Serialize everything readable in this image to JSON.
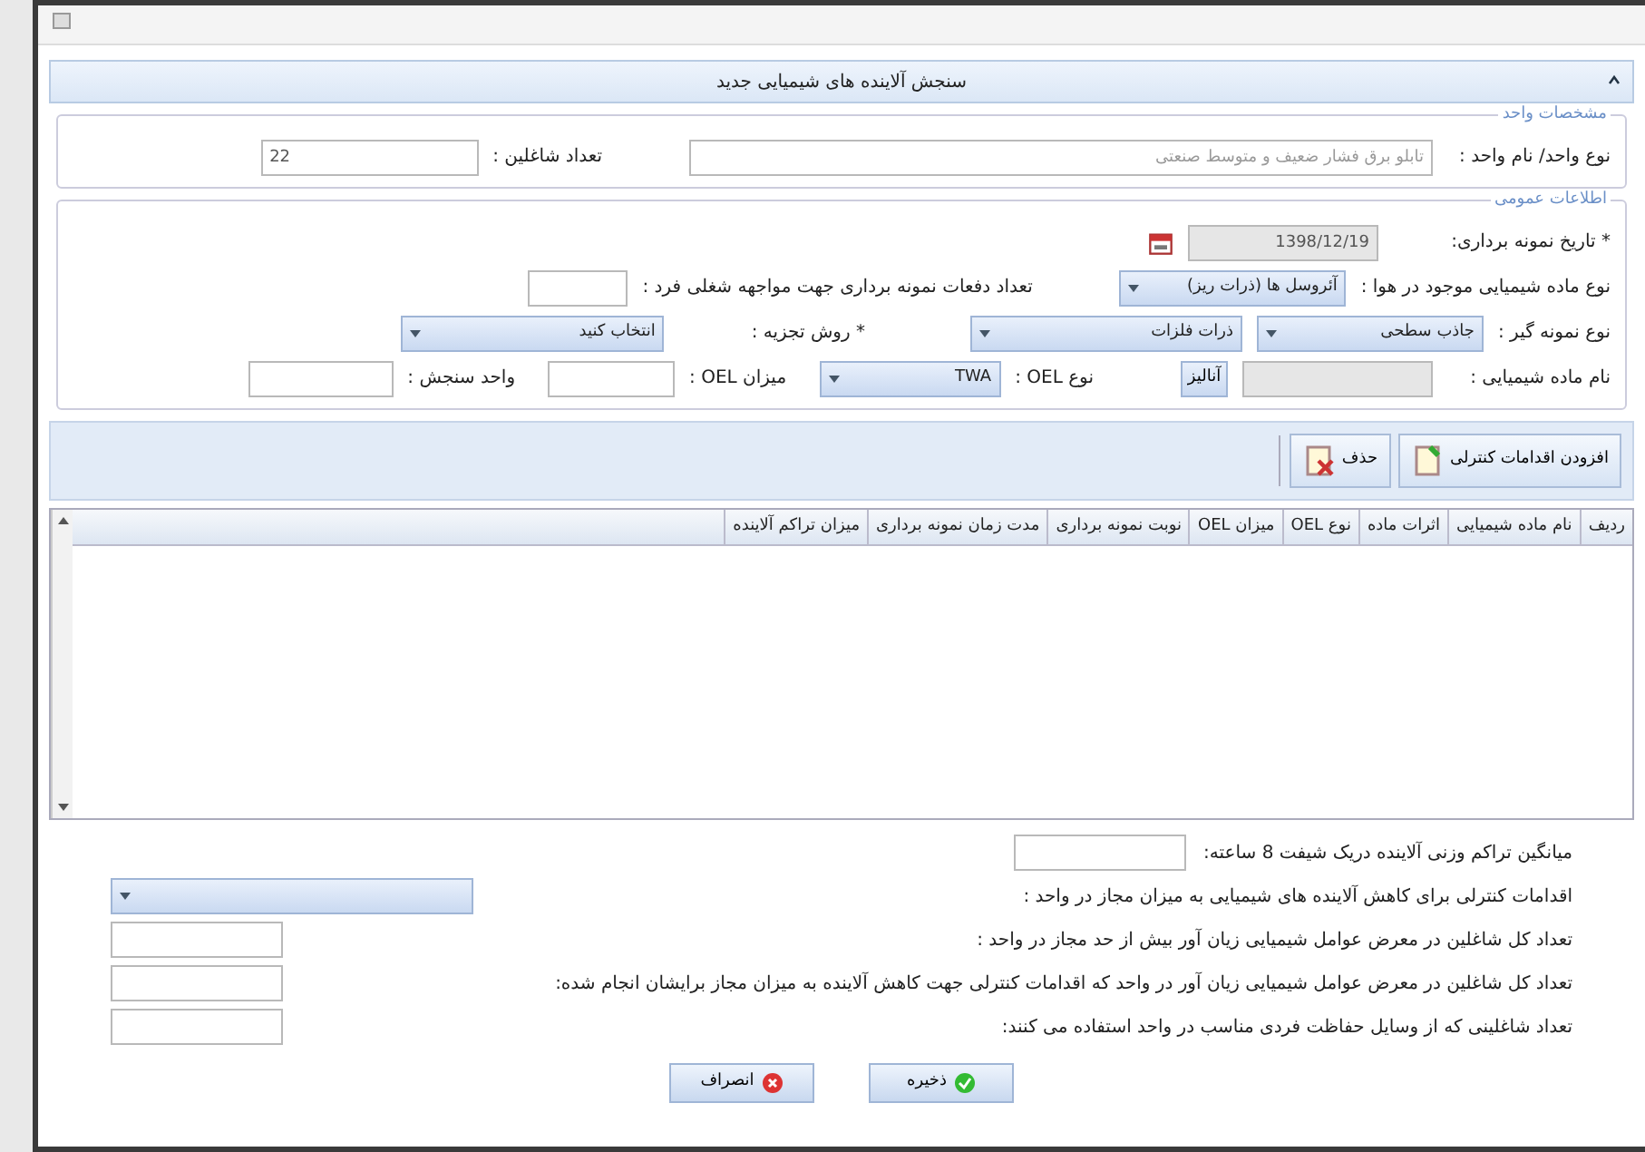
{
  "panel": {
    "title": "سنجش آلاینده های شیمیایی جدید",
    "expanded": true
  },
  "unit_info": {
    "legend": "مشخصات واحد",
    "unit_label": "نوع واحد/ نام واحد :",
    "unit_value": "تابلو برق فشار ضعیف و متوسط صنعتی",
    "workers_label": "تعداد شاغلین :",
    "workers_value": "22"
  },
  "general_info": {
    "legend": "اطلاعات عمومی",
    "date_label": "* تاریخ نمونه برداری:",
    "date_value": "1398/12/19",
    "substance_type_label": "نوع ماده شیمیایی موجود در هوا :",
    "substance_type_value": "آئروسل ها (ذرات ريز)",
    "sampling_count_label": "تعداد دفعات نمونه برداری جهت مواجهه شغلی فرد :",
    "sampler_label": "نوع نمونه گیر :",
    "sampler_value": "جاذب سطحی",
    "sampler_value_2": "ذرات فلزات",
    "method_label": "* روش تجزیه :",
    "method_value": "انتخاب کنید",
    "chemical_name_label": "نام ماده شیمیایی :",
    "lookup_button": "آنالیز",
    "oel_type_label": "نوع OEL :",
    "oel_type_value": "TWA",
    "oel_value_label": "میزان OEL :",
    "unit_measure_label": "واحد سنجش :"
  },
  "toolbar": [
    {
      "label": "افزودن اقدامات کنترلی",
      "kind": "add"
    },
    {
      "label": "حذف",
      "kind": "delete"
    }
  ],
  "table": {
    "columns": [
      "ردیف",
      "نام ماده شیمیایی",
      "اثرات ماده",
      "نوع OEL",
      "میزان OEL",
      "نوبت نمونه برداری",
      "مدت زمان نمونه برداری",
      "میزان تراکم آلاینده"
    ]
  },
  "average": {
    "label": "میانگین تراکم وزنی آلاینده دریک شیفت 8 ساعته:"
  },
  "fields": [
    {
      "label": "اقدامات کنترلی برای کاهش آلاینده های شیمیایی به میزان مجاز در واحد :",
      "kind": "select"
    },
    {
      "label": "تعداد کل شاغلین در معرض عوامل شیمیایی زیان آور بیش از حد مجاز در واحد :",
      "kind": "text"
    },
    {
      "label": "تعداد کل شاغلین در معرض عوامل شیمیایی زیان آور در واحد که اقدامات کنترلی جهت کاهش آلاینده به میزان مجاز برایشان انجام شده:",
      "kind": "text"
    },
    {
      "label": "تعداد شاغلینی که از وسایل حفاظت فردی مناسب در واحد استفاده می کنند:",
      "kind": "text"
    }
  ],
  "buttons": [
    {
      "label": "ذخیره",
      "kind": "save"
    },
    {
      "label": "انصراف",
      "kind": "cancel"
    }
  ]
}
